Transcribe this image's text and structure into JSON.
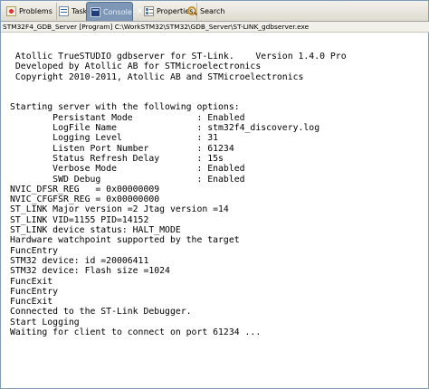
{
  "tabs": [
    {
      "id": "problems",
      "label": "Problems",
      "icon": "problems-icon"
    },
    {
      "id": "tasks",
      "label": "Tasks",
      "icon": "tasks-icon"
    },
    {
      "id": "console",
      "label": "Console",
      "icon": "console-icon",
      "active": true,
      "close_symbol": "✕"
    },
    {
      "id": "properties",
      "label": "Properties",
      "icon": "properties-icon"
    },
    {
      "id": "search",
      "label": "Search",
      "icon": "search-icon"
    }
  ],
  "console": {
    "title": "STM32F4_GDB_Server [Program] C:\\WorkSTM32\\STM32\\GDB_Server\\ST-LINK_gdbserver.exe",
    "lines": [
      " Atollic TrueSTUDIO gdbserver for ST-Link.    Version 1.4.0 Pro",
      " Developed by Atollic AB for STMicroelectronics",
      " Copyright 2010-2011, Atollic AB and STMicroelectronics",
      "",
      "",
      "Starting server with the following options:",
      "        Persistant Mode            : Enabled",
      "        LogFile Name               : stm32f4_discovery.log",
      "        Logging Level              : 31",
      "        Listen Port Number         : 61234",
      "        Status Refresh Delay       : 15s",
      "        Verbose Mode               : Enabled",
      "        SWD Debug                  : Enabled",
      "NVIC_DFSR_REG   = 0x00000009",
      "NVIC_CFGFSR_REG = 0x00000000",
      "ST_LINK Major version =2 Jtag version =14",
      "ST_LINK VID=1155 PID=14152",
      "ST_LINK device status: HALT_MODE",
      "Hardware watchpoint supported by the target",
      "FuncEntry",
      "STM32 device: id =20006411",
      "STM32 device: Flash size =1024",
      "FuncExit",
      "FuncEntry",
      "FuncExit",
      "Connected to the ST-Link Debugger.",
      "Start Logging",
      "Waiting for client to connect on port 61234 ..."
    ]
  }
}
